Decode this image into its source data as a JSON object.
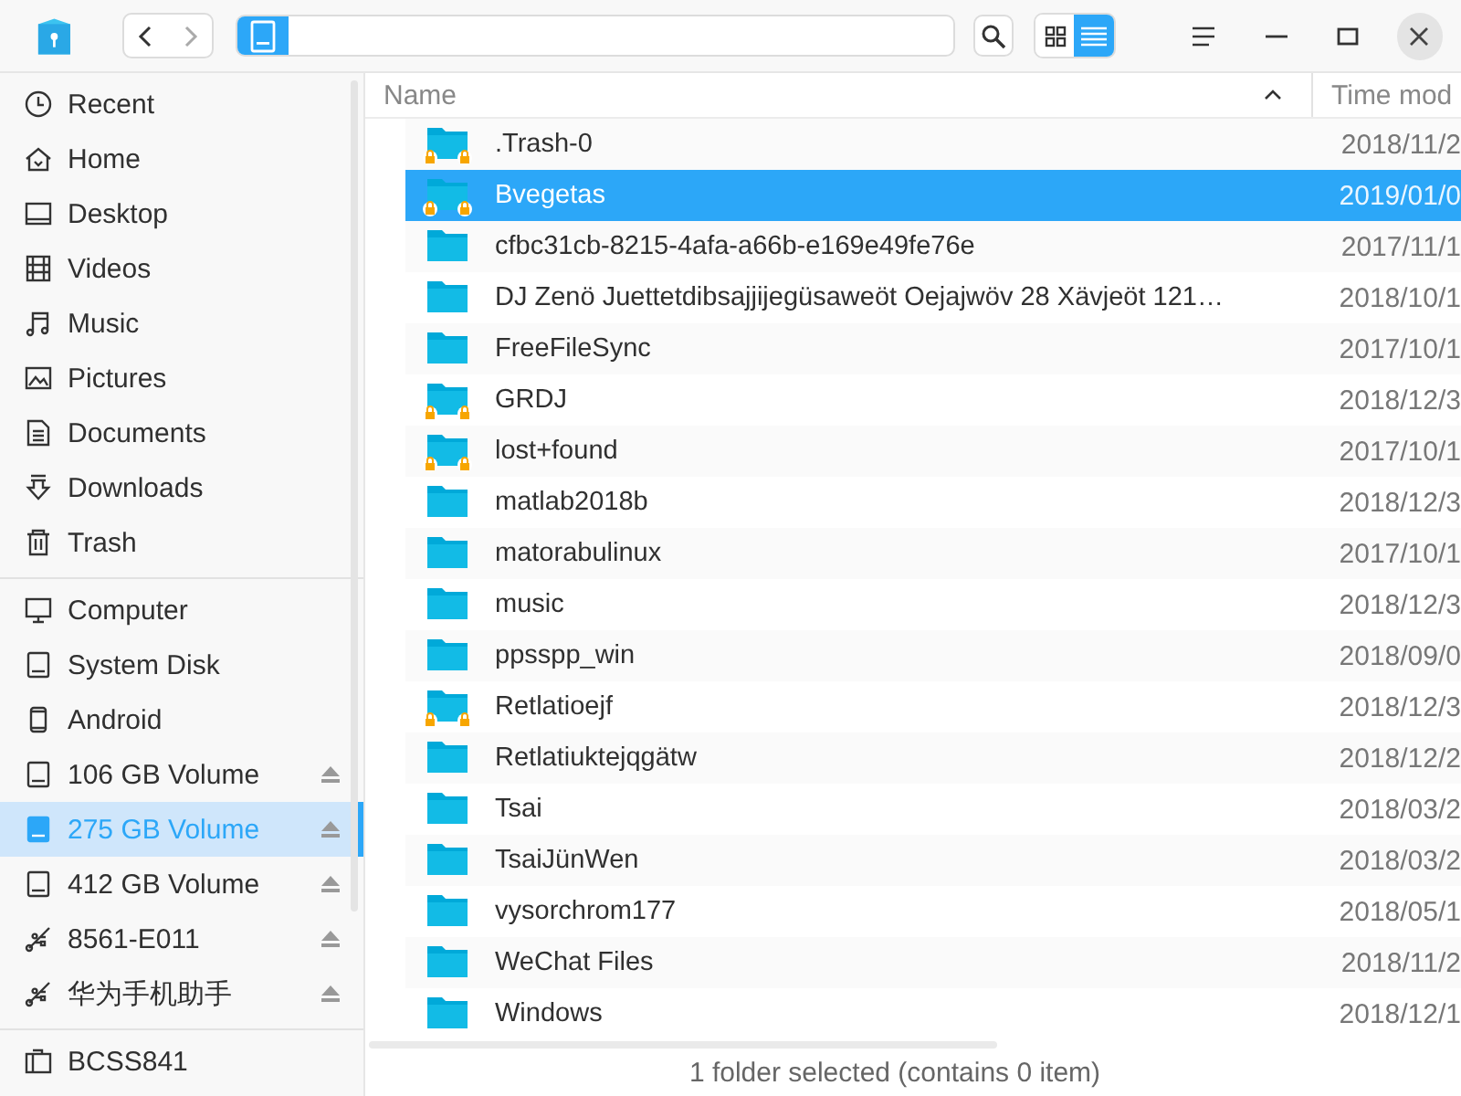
{
  "toolbar": {
    "view_buttons": [
      {
        "kind": "grid",
        "selected": false
      },
      {
        "kind": "list",
        "selected": true
      }
    ]
  },
  "sidebar": {
    "groups": [
      {
        "items": [
          {
            "label": "Recent",
            "kind": "recent",
            "selected": false,
            "eject": false
          },
          {
            "label": "Home",
            "kind": "home",
            "selected": false,
            "eject": false
          },
          {
            "label": "Desktop",
            "kind": "desktop",
            "selected": false,
            "eject": false
          },
          {
            "label": "Videos",
            "kind": "videos",
            "selected": false,
            "eject": false
          },
          {
            "label": "Music",
            "kind": "music",
            "selected": false,
            "eject": false
          },
          {
            "label": "Pictures",
            "kind": "pictures",
            "selected": false,
            "eject": false
          },
          {
            "label": "Documents",
            "kind": "documents",
            "selected": false,
            "eject": false
          },
          {
            "label": "Downloads",
            "kind": "downloads",
            "selected": false,
            "eject": false
          },
          {
            "label": "Trash",
            "kind": "trash",
            "selected": false,
            "eject": false
          }
        ]
      },
      {
        "items": [
          {
            "label": "Computer",
            "kind": "computer",
            "selected": false,
            "eject": false
          },
          {
            "label": "System Disk",
            "kind": "disk",
            "selected": false,
            "eject": false
          },
          {
            "label": "Android",
            "kind": "phone",
            "selected": false,
            "eject": false
          },
          {
            "label": "106 GB Volume",
            "kind": "disk",
            "selected": false,
            "eject": true
          },
          {
            "label": "275 GB Volume",
            "kind": "disk",
            "selected": true,
            "eject": true
          },
          {
            "label": "412 GB Volume",
            "kind": "disk",
            "selected": false,
            "eject": true
          },
          {
            "label": "8561-E011",
            "kind": "usb",
            "selected": false,
            "eject": true
          },
          {
            "label": "华为手机助手",
            "kind": "usb",
            "selected": false,
            "eject": true
          }
        ]
      },
      {
        "items": [
          {
            "label": "BCSS841",
            "kind": "network",
            "selected": false,
            "eject": false
          }
        ]
      }
    ]
  },
  "table": {
    "columns": [
      "Name",
      "Time mod"
    ],
    "rows": [
      {
        "name": ".Trash-0",
        "time": "2018/11/2",
        "locked": true,
        "selected": false
      },
      {
        "name": "Bvegetas",
        "time": "2019/01/0",
        "locked": true,
        "selected": true
      },
      {
        "name": "cfbc31cb-8215-4afa-a66b-e169e49fe76e",
        "time": "2017/11/1",
        "locked": false,
        "selected": false
      },
      {
        "name": "DJ Zenö Juettetdibsajjijegüsaweöt Oejajwöv 28 Xävjeöt 121…",
        "time": "2018/10/1",
        "locked": false,
        "selected": false
      },
      {
        "name": "FreeFileSync",
        "time": "2017/10/1",
        "locked": false,
        "selected": false
      },
      {
        "name": "GRDJ",
        "time": "2018/12/3",
        "locked": true,
        "selected": false
      },
      {
        "name": "lost+found",
        "time": "2017/10/1",
        "locked": true,
        "selected": false
      },
      {
        "name": "matlab2018b",
        "time": "2018/12/3",
        "locked": false,
        "selected": false
      },
      {
        "name": "matorabulinux",
        "time": "2017/10/1",
        "locked": false,
        "selected": false
      },
      {
        "name": "music",
        "time": "2018/12/3",
        "locked": false,
        "selected": false
      },
      {
        "name": "ppsspp_win",
        "time": "2018/09/0",
        "locked": false,
        "selected": false
      },
      {
        "name": "Retlatioejf",
        "time": "2018/12/3",
        "locked": true,
        "selected": false
      },
      {
        "name": "Retlatiuktejqgätw",
        "time": "2018/12/2",
        "locked": false,
        "selected": false
      },
      {
        "name": "Tsai",
        "time": "2018/03/2",
        "locked": false,
        "selected": false
      },
      {
        "name": "TsaiJünWen",
        "time": "2018/03/2",
        "locked": false,
        "selected": false
      },
      {
        "name": "vysorchrom177",
        "time": "2018/05/1",
        "locked": false,
        "selected": false
      },
      {
        "name": "WeChat Files",
        "time": "2018/11/2",
        "locked": false,
        "selected": false
      },
      {
        "name": "Windows",
        "time": "2018/12/1",
        "locked": false,
        "selected": false
      }
    ]
  },
  "status_bar": "1 folder selected (contains 0 item)"
}
